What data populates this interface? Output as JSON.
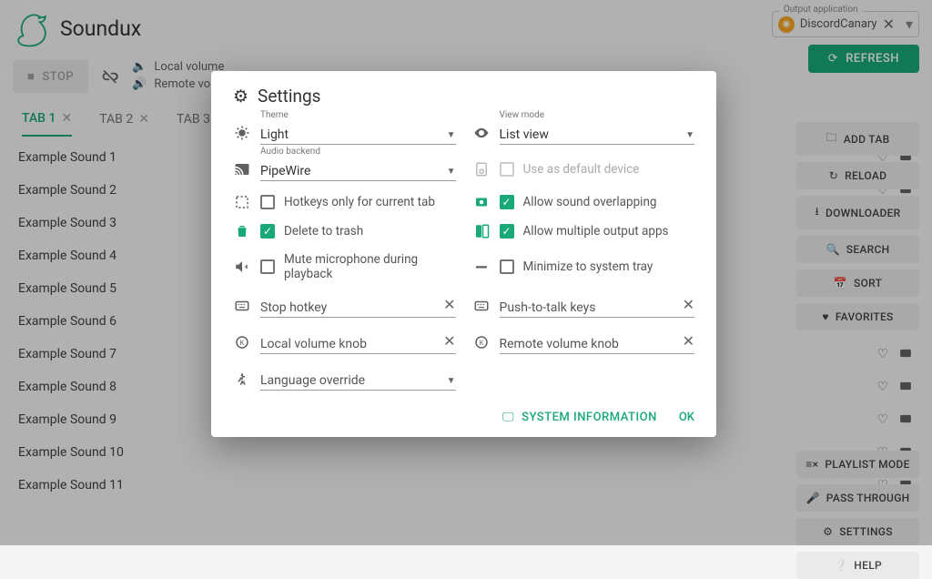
{
  "app": {
    "title": "Soundux"
  },
  "output": {
    "legend": "Output application",
    "value": "DiscordCanary"
  },
  "buttons": {
    "refresh": "REFRESH",
    "stop": "STOP",
    "addTab": "ADD TAB",
    "reload": "RELOAD",
    "downloader": "DOWNLOADER",
    "search": "SEARCH",
    "sort": "SORT",
    "favorites": "FAVORITES",
    "playlist": "PLAYLIST MODE",
    "passthrough": "PASS THROUGH",
    "settings": "SETTINGS",
    "help": "HELP"
  },
  "volumes": {
    "local": "Local volume",
    "remote": "Remote volume"
  },
  "tabs": [
    {
      "label": "TAB 1",
      "active": true
    },
    {
      "label": "TAB 2",
      "active": false
    },
    {
      "label": "TAB 3",
      "active": false
    }
  ],
  "sounds": [
    "Example Sound 1",
    "Example Sound 2",
    "Example Sound 3",
    "Example Sound 4",
    "Example Sound 5",
    "Example Sound 6",
    "Example Sound 7",
    "Example Sound 8",
    "Example Sound 9",
    "Example Sound 10",
    "Example Sound 11"
  ],
  "modal": {
    "title": "Settings",
    "theme": {
      "label": "Theme",
      "value": "Light"
    },
    "viewmode": {
      "label": "View mode",
      "value": "List view"
    },
    "backend": {
      "label": "Audio backend",
      "value": "PipeWire"
    },
    "defaultDevice": "Use as default device",
    "hotkeysTab": "Hotkeys only for current tab",
    "overlap": "Allow sound overlapping",
    "deleteTrash": "Delete to trash",
    "multiOut": "Allow multiple output apps",
    "muteMic": "Mute microphone during playback",
    "minTray": "Minimize to system tray",
    "stopHotkey": "Stop hotkey",
    "pttKeys": "Push-to-talk keys",
    "localKnob": "Local volume knob",
    "remoteKnob": "Remote volume knob",
    "langOverride": "Language override",
    "sysinfo": "SYSTEM INFORMATION",
    "ok": "OK"
  }
}
